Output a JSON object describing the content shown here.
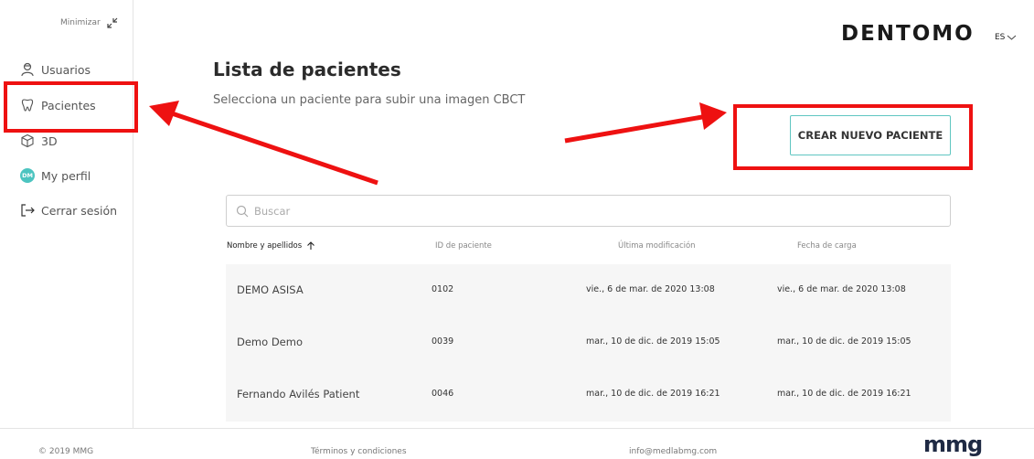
{
  "sidebar": {
    "minimize_label": "Minimizar",
    "items": [
      {
        "label": "Usuarios",
        "icon": "user-icon"
      },
      {
        "label": "Pacientes",
        "icon": "tooth-icon"
      },
      {
        "label": "3D",
        "icon": "cube-icon"
      },
      {
        "label": "My perfil",
        "avatar": "DM"
      },
      {
        "label": "Cerrar sesión",
        "icon": "logout-icon"
      }
    ]
  },
  "header": {
    "brand": "DENTOMO",
    "language": "ES"
  },
  "main": {
    "title": "Lista de pacientes",
    "subtitle": "Selecciona un paciente para subir una imagen CBCT",
    "create_button": "CREAR NUEVO PACIENTE",
    "search_placeholder": "Buscar",
    "columns": [
      "Nombre y apellidos",
      "ID de paciente",
      "Última modificación",
      "Fecha de carga"
    ],
    "rows": [
      {
        "name": "DEMO ASISA",
        "id": "0102",
        "modified": "vie., 6 de mar. de 2020 13:08",
        "uploaded": "vie., 6 de mar. de 2020 13:08"
      },
      {
        "name": "Demo Demo",
        "id": "0039",
        "modified": "mar., 10 de dic. de 2019 15:05",
        "uploaded": "mar., 10 de dic. de 2019 15:05"
      },
      {
        "name": "Fernando Avilés Patient",
        "id": "0046",
        "modified": "mar., 10 de dic. de 2019 16:21",
        "uploaded": "mar., 10 de dic. de 2019 16:21"
      }
    ]
  },
  "footer": {
    "copyright": "© 2019 MMG",
    "terms": "Términos y condiciones",
    "email": "info@medlabmg.com",
    "logo": "mmg"
  },
  "colors": {
    "accent": "#4cc4c0",
    "annotation": "#ee1111",
    "row_bg": "#f6f6f6"
  }
}
